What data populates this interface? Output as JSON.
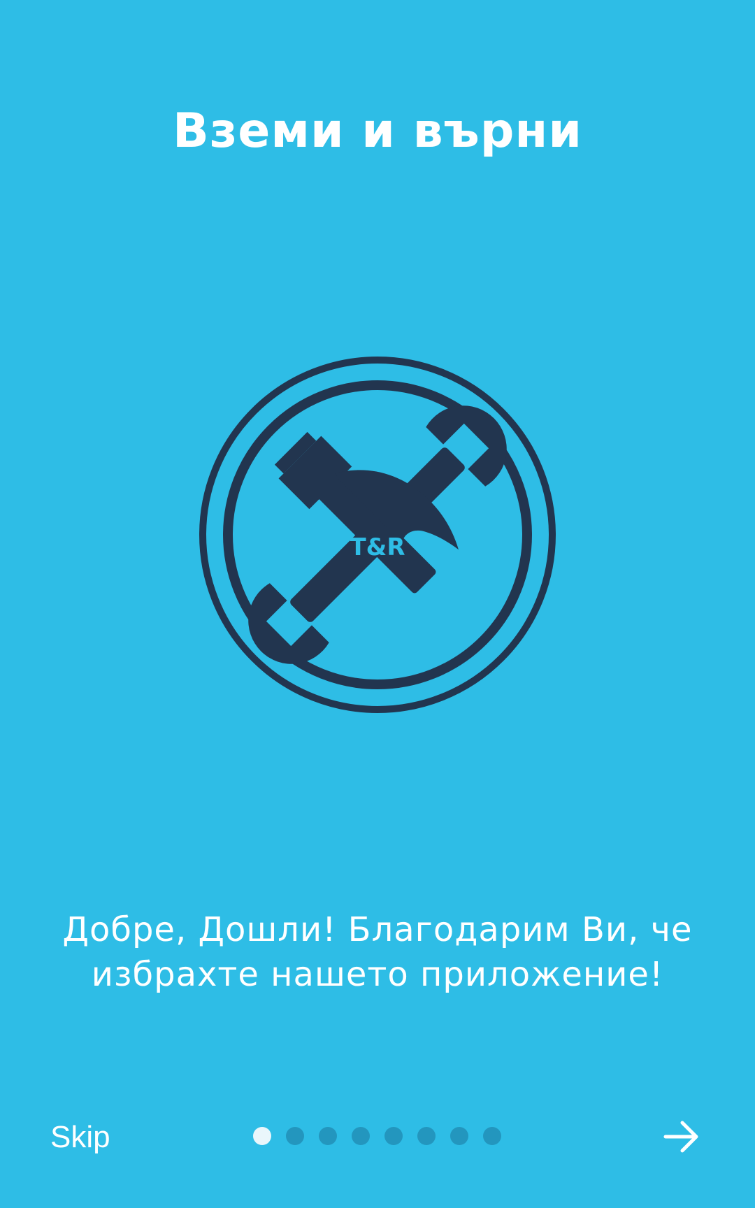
{
  "onboarding": {
    "title": "Вземи и върни",
    "logo_text": "T&R",
    "description": "Добре, Дошли! Благодарим Ви, че избрахте нашето приложение!",
    "skip_label": "Skip",
    "pager": {
      "total_pages": 8,
      "current_page": 1
    },
    "next_icon": "arrow-right-icon",
    "logo_icon": "hammer-wrench-icon"
  },
  "colors": {
    "background": "#2ebde6",
    "logo_dark": "#22354f",
    "dot_active": "#eaf6fb",
    "dot_inactive": "#2396be",
    "text": "#ffffff"
  }
}
